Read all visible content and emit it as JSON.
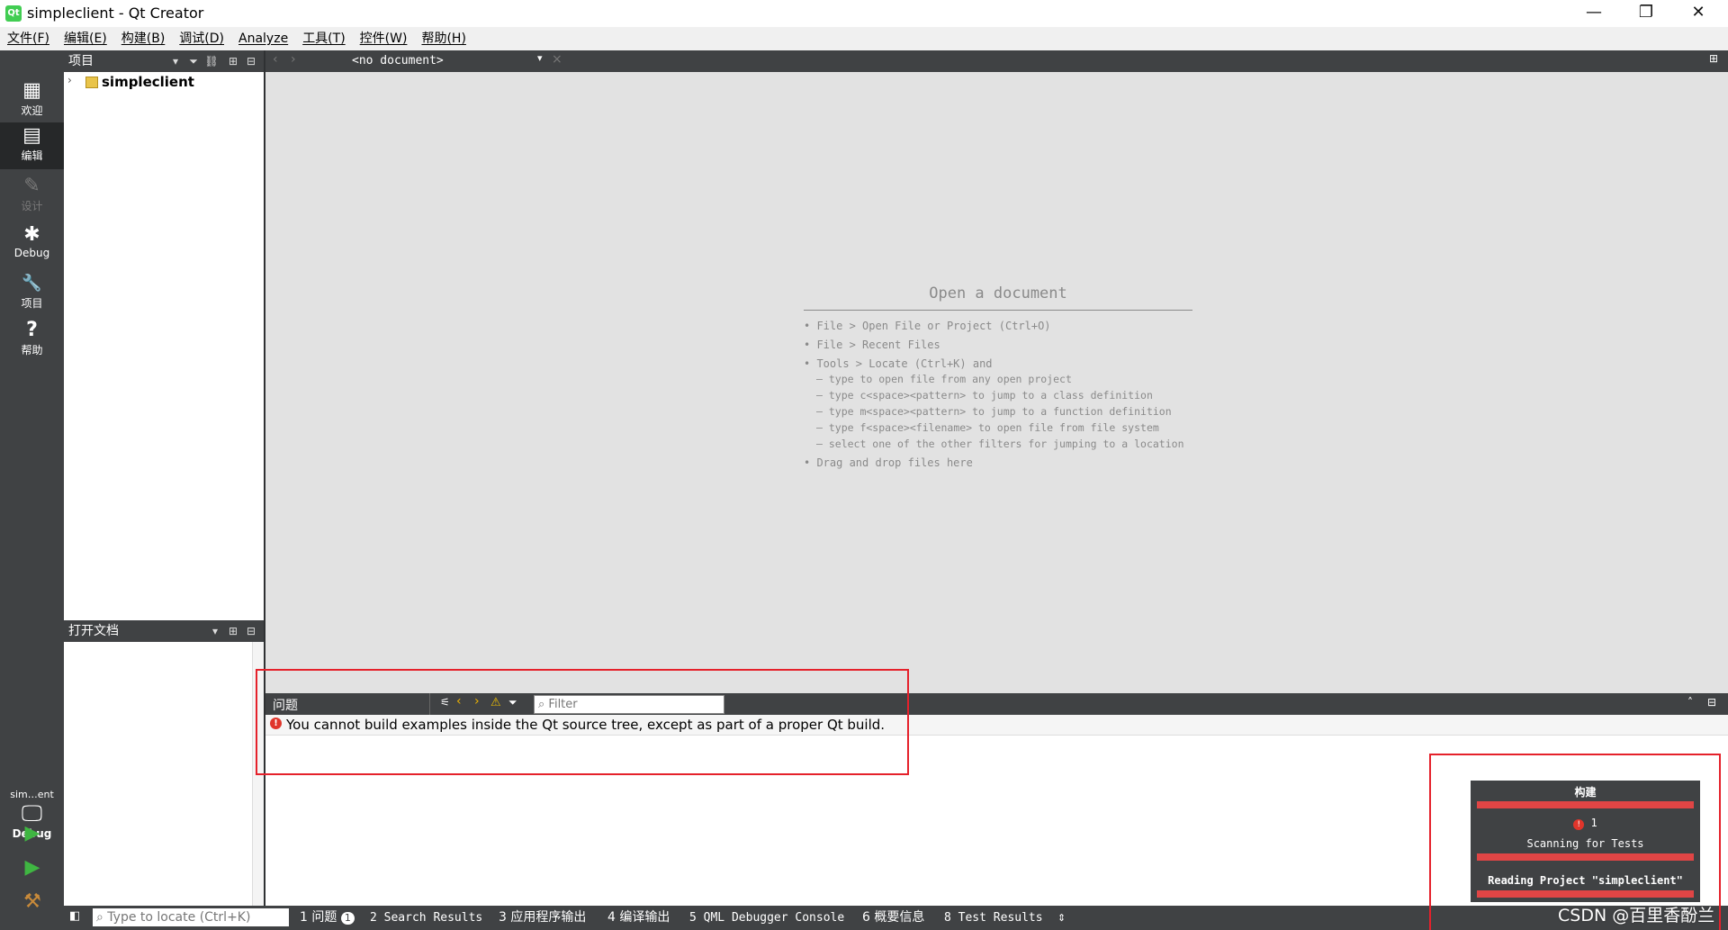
{
  "window": {
    "title": "simpleclient - Qt Creator",
    "icon": "qt-icon",
    "minimize": "—",
    "restore": "❐",
    "close": "✕"
  },
  "menu": [
    "文件(F)",
    "编辑(E)",
    "构建(B)",
    "调试(D)",
    "Analyze",
    "工具(T)",
    "控件(W)",
    "帮助(H)"
  ],
  "modes": [
    {
      "label": "欢迎",
      "icon": "grid-icon",
      "glyph": "▦"
    },
    {
      "label": "编辑",
      "icon": "edit-icon",
      "glyph": "▤"
    },
    {
      "label": "设计",
      "icon": "pencil-icon",
      "glyph": "✎"
    },
    {
      "label": "Debug",
      "icon": "bug-icon",
      "glyph": "✱"
    },
    {
      "label": "项目",
      "icon": "wrench-icon",
      "glyph": "🔧"
    },
    {
      "label": "帮助",
      "icon": "help-icon",
      "glyph": "?"
    }
  ],
  "projects": {
    "header": "项目",
    "tree_root": "simpleclient"
  },
  "open_docs": {
    "header": "打开文档"
  },
  "editor": {
    "doc_selector": "<no document>",
    "hint_title": "Open a document",
    "hints": [
      "• File > Open File or Project (Ctrl+O)",
      "• File > Recent Files",
      "• Tools > Locate (Ctrl+K) and"
    ],
    "sub_hints": [
      "– type to open file from any open project",
      "– type c<space><pattern> to jump to a class definition",
      "– type m<space><pattern> to jump to a function definition",
      "– type f<space><filename> to open file from file system",
      "– select one of the other filters for jumping to a location"
    ],
    "last_hint": "• Drag and drop files here"
  },
  "issues": {
    "header": "问题",
    "filter_placeholder": "Filter",
    "message": "You cannot build examples inside the Qt source tree, except as part of a proper Qt build."
  },
  "kit": {
    "name": "sim…ent",
    "mode": "Debug"
  },
  "statusbar": {
    "locate_placeholder": "Type to locate (Ctrl+K)",
    "tabs": [
      {
        "num": "1",
        "label": "问题",
        "badge": "1"
      },
      {
        "num": "2",
        "label": "Search Results"
      },
      {
        "num": "3",
        "label": "应用程序输出"
      },
      {
        "num": "4",
        "label": "编译输出"
      },
      {
        "num": "5",
        "label": "QML Debugger Console"
      },
      {
        "num": "6",
        "label": "概要信息"
      },
      {
        "num": "8",
        "label": "Test Results"
      }
    ]
  },
  "progress": {
    "title": "构建",
    "error_count": "1",
    "task1": "Scanning for Tests",
    "task2": "Reading Project \"simpleclient\""
  },
  "watermark": "CSDN @百里香酚兰",
  "colors": {
    "accent_red": "#e04545",
    "annotation_red": "#e5212b",
    "dark_panel": "#404244"
  }
}
